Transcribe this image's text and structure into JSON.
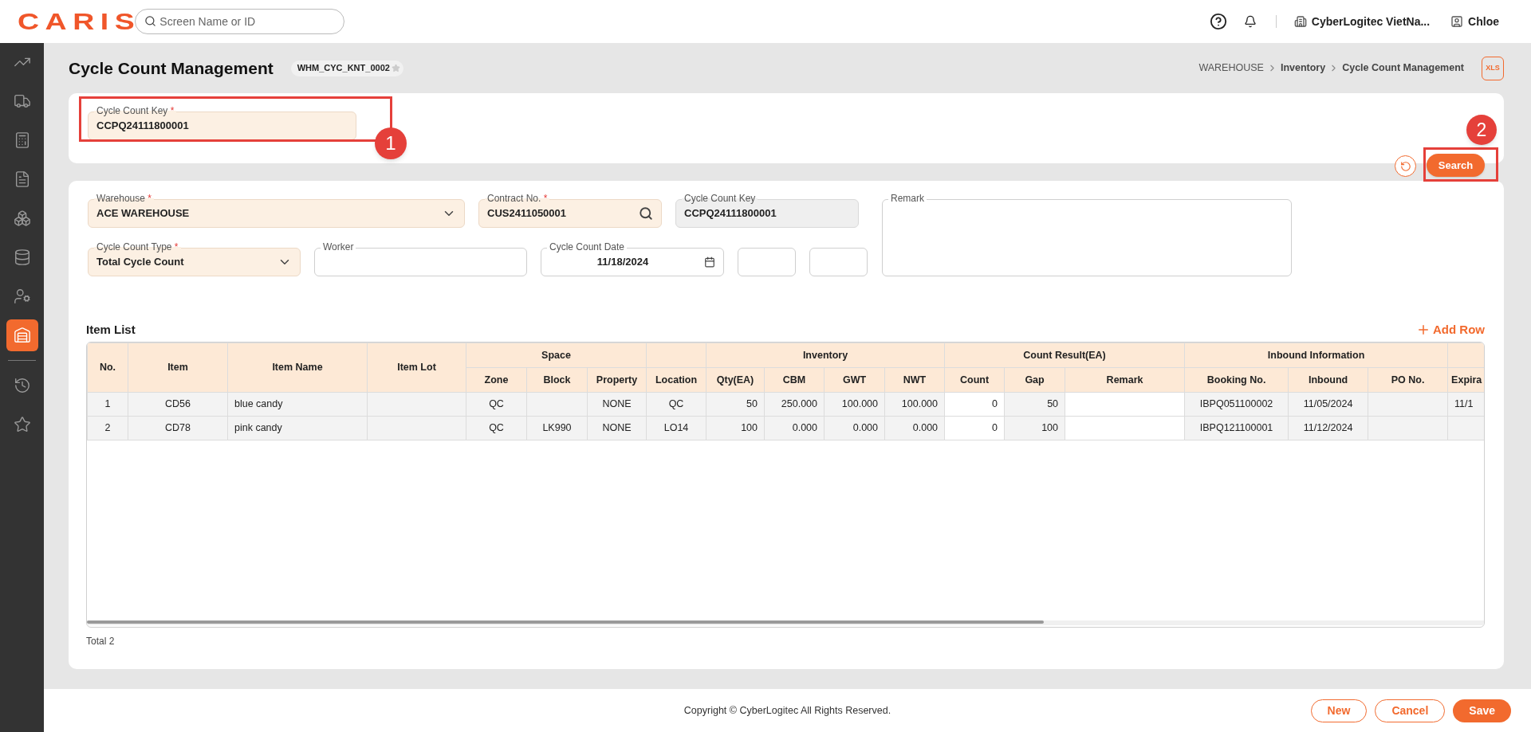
{
  "required_mark": "*",
  "topbar": {
    "logo": "CARIS",
    "search": {
      "placeholder": "Screen Name or ID"
    },
    "company": "CyberLogitec VietNa...",
    "user": "Chloe"
  },
  "sidebar": {
    "items": [
      {
        "selected": false
      },
      {
        "selected": false
      },
      {
        "selected": false
      },
      {
        "selected": false
      },
      {
        "selected": false
      },
      {
        "selected": false
      },
      {
        "selected": false
      },
      {
        "selected": true
      },
      {
        "selected": false
      },
      {
        "selected": false
      }
    ]
  },
  "header": {
    "title": "Cycle Count Management",
    "screen_id": "WHM_CYC_KNT_0002",
    "favorite": false,
    "breadcrumb": [
      "WAREHOUSE",
      "Inventory",
      "Cycle Count Management"
    ],
    "export_label": "XLS"
  },
  "filter": {
    "field": {
      "label": "Cycle Count Key",
      "required": true,
      "value": "CCPQ24111800001"
    },
    "search_button": "Search"
  },
  "annotations": [
    {
      "label": "1"
    },
    {
      "label": "2"
    }
  ],
  "form": {
    "rows": [
      [
        {
          "kind": "select",
          "label": "Warehouse",
          "required": true,
          "value": "ACE WAREHOUSE"
        },
        {
          "kind": "search",
          "label": "Contract No.",
          "required": true,
          "value": "CUS2411050001"
        },
        {
          "kind": "readonly",
          "label": "Cycle Count Key",
          "required": false,
          "value": "CCPQ24111800001"
        }
      ],
      [
        {
          "kind": "select",
          "label": "Cycle Count Type",
          "required": true,
          "value": "Total Cycle Count"
        },
        {
          "kind": "text",
          "label": "Worker",
          "required": false
        },
        {
          "kind": "date",
          "label": "Cycle Count Date",
          "required": false,
          "value": "11/18/2024"
        },
        {
          "kind": "blank",
          "required": false
        },
        {
          "kind": "blank",
          "required": false
        }
      ]
    ],
    "remark": {
      "label": "Remark"
    }
  },
  "table": {
    "title": "Item List",
    "add_button": "Add Row",
    "header_groups": [
      {
        "kind": "single",
        "label": "No."
      },
      {
        "kind": "single",
        "label": "Item"
      },
      {
        "kind": "single",
        "label": "Item Name"
      },
      {
        "kind": "single",
        "label": "Item Lot"
      },
      {
        "kind": "group",
        "label": "Space",
        "columns": [
          "Zone",
          "Block",
          "Property"
        ]
      },
      {
        "kind": "group",
        "columns": [
          "Location"
        ]
      },
      {
        "kind": "group",
        "label": "Inventory",
        "columns": [
          "Qty(EA)",
          "CBM",
          "GWT",
          "NWT"
        ]
      },
      {
        "kind": "group",
        "label": "Count Result(EA)",
        "columns": [
          "Count",
          "Gap",
          "Remark"
        ]
      },
      {
        "kind": "group",
        "label": "Inbound Information",
        "columns": [
          "Booking No.",
          "Inbound",
          "PO No."
        ]
      },
      {
        "kind": "group",
        "columns": [
          "Expira"
        ]
      }
    ],
    "rows": [
      {
        "cells": [
          "1",
          "CD56",
          "blue candy",
          null,
          "QC",
          null,
          "NONE",
          "QC",
          "50",
          "250.000",
          "100.000",
          "100.000",
          "0",
          "50",
          null,
          "IBPQ051100002",
          "11/05/2024",
          null,
          "11/1"
        ]
      },
      {
        "cells": [
          "2",
          "CD78",
          "pink candy",
          null,
          "QC",
          "LK990",
          "NONE",
          "LO14",
          "100",
          "0.000",
          "0.000",
          "0.000",
          "0",
          "100",
          null,
          "IBPQ121100001",
          "11/12/2024",
          null,
          null
        ]
      }
    ],
    "total": "Total 2"
  },
  "footer": {
    "copyright": "Copyright © CyberLogitec All Rights Reserved.",
    "buttons": [
      {
        "label": "New",
        "kind": "outline"
      },
      {
        "label": "Cancel",
        "kind": "outline"
      },
      {
        "label": "Save",
        "kind": "filled"
      }
    ]
  }
}
